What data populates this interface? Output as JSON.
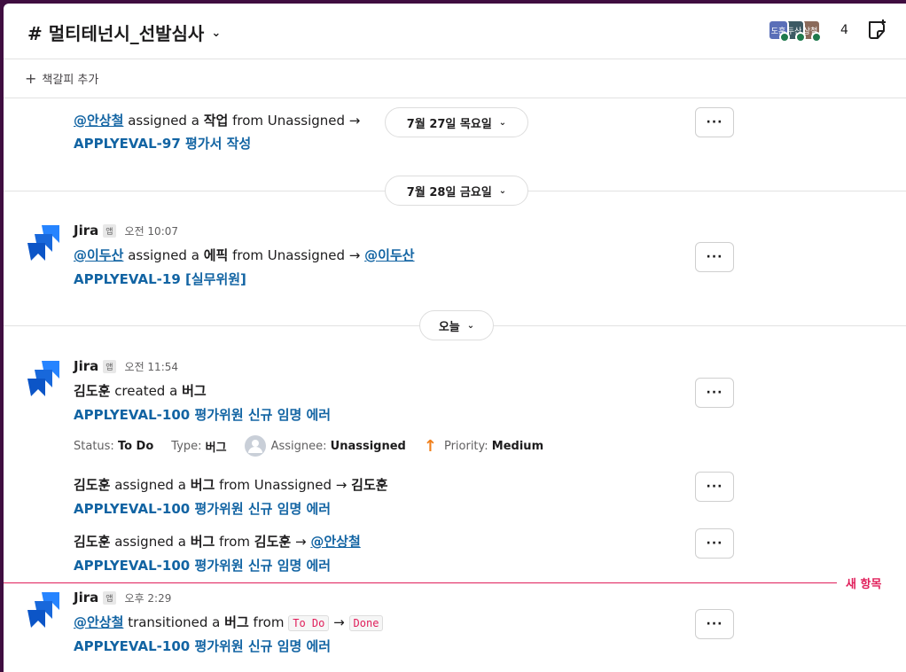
{
  "header": {
    "channel_name": "# 멀티테넌시_선발심사",
    "chevron": "⌄",
    "members": [
      {
        "initials": "도훈",
        "color": "#5a6fb8"
      },
      {
        "initials": "두산",
        "color": "#3d5a64"
      },
      {
        "initials": "상철",
        "color": "#8a6a5a"
      }
    ],
    "member_count": "4",
    "canvas_icon": "canvas-icon"
  },
  "bookmarks": {
    "plus": "+",
    "add_label": "책갈피 추가"
  },
  "dates": {
    "d1": "7월 27일 목요일",
    "d2": "7월 28일 금요일",
    "d3": "오늘",
    "chevron": "⌄"
  },
  "more_label": "···",
  "messages": {
    "m0": {
      "mention": "@안상철",
      "text1": "assigned a",
      "kw": "작업",
      "text2": "from Unassigned →",
      "issue": "APPLYEVAL-97 평가서 작성"
    },
    "m1": {
      "sender": "Jira",
      "badge": "앱",
      "time": "오전 10:07",
      "mention1": "@이두산",
      "text1": "assigned a",
      "kw": "에픽",
      "text2": "from Unassigned →",
      "mention2": "@이두산",
      "issue": "APPLYEVAL-19 [실무위원]"
    },
    "m2": {
      "sender": "Jira",
      "badge": "앱",
      "time": "오전 11:54",
      "actor": "김도훈",
      "text1": "created a",
      "kw": "버그",
      "issue": "APPLYEVAL-100 평가위원 신규 임명 에러",
      "fields": {
        "status_label": "Status:",
        "status_value": "To Do",
        "type_label": "Type:",
        "type_value": "버그",
        "assignee_label": "Assignee:",
        "assignee_value": "Unassigned",
        "priority_arrow": "↑",
        "priority_label": "Priority:",
        "priority_value": "Medium"
      }
    },
    "m3": {
      "actor": "김도훈",
      "text1": "assigned a",
      "kw": "버그",
      "text2": "from Unassigned →",
      "target": "김도훈",
      "issue": "APPLYEVAL-100 평가위원 신규 임명 에러"
    },
    "m4": {
      "actor": "김도훈",
      "text1": "assigned a",
      "kw": "버그",
      "text2": "from",
      "from": "김도훈",
      "arrow": "→",
      "mention": "@안상철",
      "issue": "APPLYEVAL-100 평가위원 신규 임명 에러"
    },
    "m5": {
      "sender": "Jira",
      "badge": "앱",
      "time": "오후 2:29",
      "mention": "@안상철",
      "text1": "transitioned a",
      "kw": "버그",
      "text2": "from",
      "code_from": "To Do",
      "arrow": "→",
      "code_to": "Done",
      "issue": "APPLYEVAL-100 평가위원 신규 임명 에러"
    }
  },
  "new_marker": "새 항목"
}
